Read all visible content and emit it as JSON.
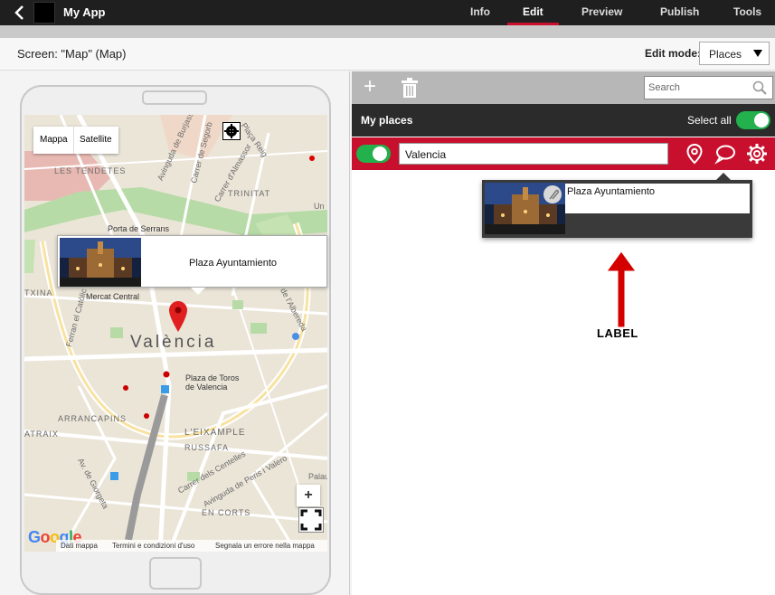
{
  "app": {
    "name": "My App"
  },
  "nav": {
    "tabs": [
      {
        "label": "Info"
      },
      {
        "label": "Edit",
        "active": true
      },
      {
        "label": "Preview"
      },
      {
        "label": "Publish"
      },
      {
        "label": "Tools"
      }
    ]
  },
  "screen": {
    "title": "Screen: \"Map\" (Map)",
    "edit_mode_label": "Edit mode:",
    "edit_mode_value": "Places"
  },
  "map": {
    "type_buttons": [
      "Mappa",
      "Satellite"
    ],
    "labels": {
      "tendetes": "LES TENDETES",
      "trinitat": "TRINITAT",
      "serrans": "Porta de Serrans",
      "mercat": "Mercat Central",
      "city": "València",
      "toros1": "Plaza de Toros",
      "toros2": "de Valencia",
      "arrancapins": "ARRANCAPINS",
      "eixample": "L'EIXAMPLE",
      "russafa": "RUSSAFA",
      "encorts": "EN CORTS",
      "txina": "TXINA",
      "atraix": "ATRAIX",
      "ferran": "Ferran el Catòlic",
      "alameda": "de l'Albereda",
      "centelles": "Carrer dels Centelles",
      "peris": "Avinguda de Peris i Valero",
      "giorgeta": "Av. de Giorgeta",
      "almassor": "Carrer d'Almassor",
      "segorb": "Carrer de Segorb",
      "burjassot": "Avinguda de Burjassot",
      "reig": "Plaça Reig",
      "palau": "Palau",
      "un": "Un"
    },
    "infowindow_title": "Plaza Ayuntamiento",
    "zoom_in": "+",
    "google": [
      "G",
      "o",
      "o",
      "g",
      "l",
      "e"
    ],
    "footer": [
      "Dati mappa",
      "Termini e condizioni d'uso",
      "Segnala un errore nella mappa"
    ]
  },
  "toolbar": {
    "add": "+",
    "search_placeholder": "Search"
  },
  "places": {
    "header": "My places",
    "select_all": "Select all",
    "items": [
      {
        "name": "Valencia",
        "enabled": true
      }
    ]
  },
  "popover": {
    "label_value": "Plaza Ayuntamiento"
  },
  "annotation": {
    "text": "LABEL"
  },
  "colors": {
    "accent": "#c8102e",
    "toggle_on": "#22b14c",
    "topbar": "#1f1f1f",
    "placesbar": "#2b2b2b"
  }
}
